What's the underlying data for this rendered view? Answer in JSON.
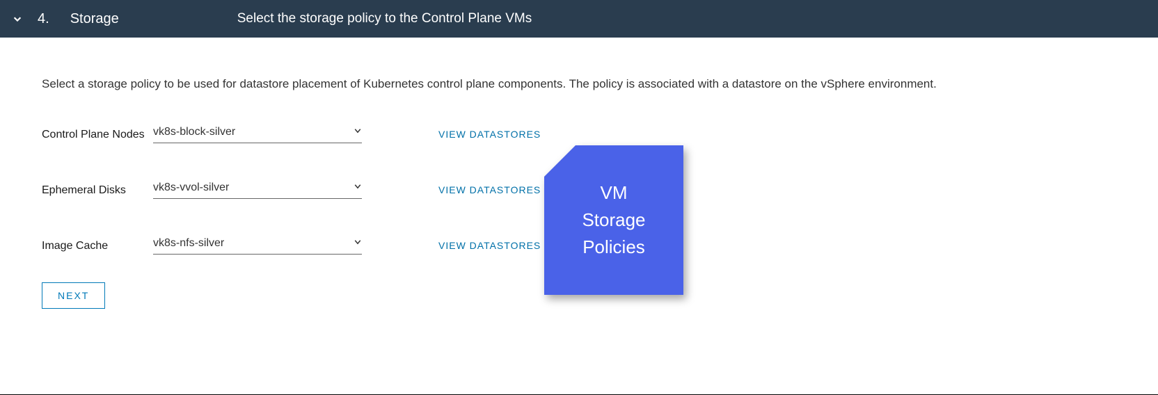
{
  "header": {
    "step_number": "4.",
    "title": "Storage",
    "subtitle": "Select the storage policy to the Control Plane VMs"
  },
  "description": "Select a storage policy to be used for datastore placement of Kubernetes control plane components. The policy is associated with a datastore on the vSphere environment.",
  "rows": [
    {
      "label": "Control Plane Nodes",
      "value": "vk8s-block-silver",
      "link": "VIEW DATASTORES"
    },
    {
      "label": "Ephemeral Disks",
      "value": "vk8s-vvol-silver",
      "link": "VIEW DATASTORES"
    },
    {
      "label": "Image Cache",
      "value": "vk8s-nfs-silver",
      "link": "VIEW DATASTORES"
    }
  ],
  "next_button": "NEXT",
  "callout": {
    "line1": "VM",
    "line2": "Storage",
    "line3": "Policies",
    "color": "#4a62e8"
  }
}
